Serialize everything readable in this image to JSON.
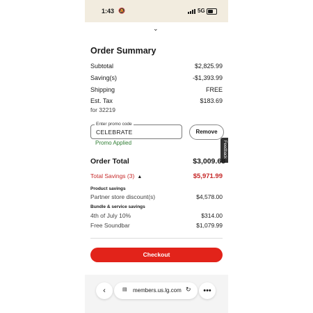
{
  "status_bar": {
    "time": "1:43",
    "network": "5G"
  },
  "order_summary": {
    "title": "Order Summary",
    "rows": [
      {
        "label": "Subtotal",
        "value": "$2,825.99"
      },
      {
        "label": "Saving(s)",
        "value": "-$1,393.99"
      },
      {
        "label": "Shipping",
        "value": "FREE"
      },
      {
        "label": "Est. Tax",
        "value": "$183.69"
      }
    ],
    "tax_zip": "for 32219"
  },
  "promo": {
    "field_label": "Enter promo code",
    "value": "CELEBRATE",
    "remove_label": "Remove",
    "status": "Promo Applied"
  },
  "feedback_label": "Feedback",
  "order_total": {
    "label": "Order Total",
    "value": "$3,009.68"
  },
  "total_savings": {
    "label": "Total Savings (3)",
    "value": "$5,971.99"
  },
  "savings_groups": [
    {
      "heading": "Product savings",
      "items": [
        {
          "label": "Partner store discount(s)",
          "value": "$4,578.00"
        }
      ]
    },
    {
      "heading": "Bundle & service savings",
      "items": [
        {
          "label": "4th of July 10%",
          "value": "$314.00"
        },
        {
          "label": "Free Soundbar",
          "value": "$1,079.99"
        }
      ]
    }
  ],
  "checkout_label": "Checkout",
  "browser": {
    "url": "members.us.lg.com"
  },
  "icons": {
    "back": "chevron-left-icon",
    "more": "more-dots-icon",
    "reload": "reload-icon",
    "collapse": "chevron-down-icon"
  },
  "colors": {
    "accent_red": "#e2231a",
    "savings_red": "#c62828",
    "promo_green": "#2e7d32",
    "status_bar_bg": "#f2ecdf"
  }
}
